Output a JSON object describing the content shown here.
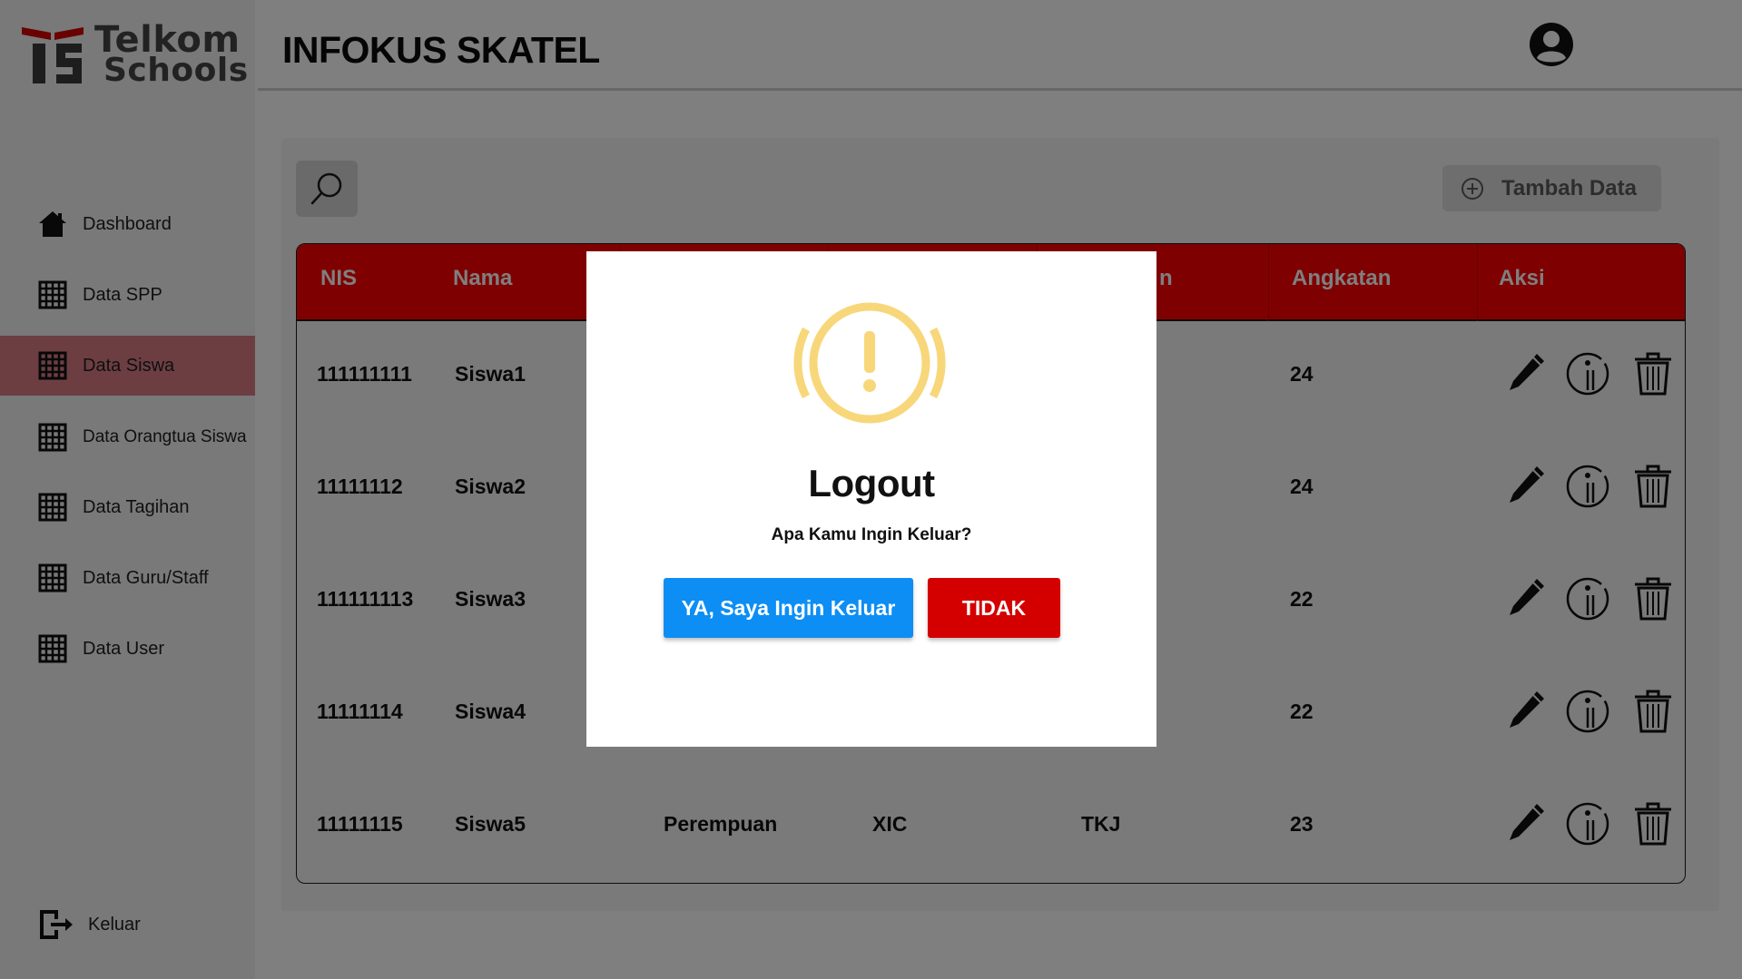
{
  "brand": {
    "line1": "Telkom",
    "line2": "Schools"
  },
  "sidebar": {
    "items": [
      {
        "label": "Dashboard",
        "icon": "home-icon"
      },
      {
        "label": "Data SPP",
        "icon": "grid-icon"
      },
      {
        "label": "Data Siswa",
        "icon": "grid-icon",
        "active": true
      },
      {
        "label": "Data Orangtua Siswa",
        "icon": "grid-icon"
      },
      {
        "label": "Data Tagihan",
        "icon": "grid-icon"
      },
      {
        "label": "Data Guru/Staff",
        "icon": "grid-icon"
      },
      {
        "label": "Data User",
        "icon": "grid-icon"
      }
    ],
    "logout_label": "Keluar"
  },
  "header": {
    "title": "INFOKUS SKATEL"
  },
  "toolbar": {
    "add_label": "Tambah Data"
  },
  "table": {
    "headers": [
      "NIS",
      "Nama",
      "",
      "",
      "n",
      "Angkatan",
      "Aksi"
    ],
    "rows": [
      {
        "nis": "111111111",
        "nama": "Siswa1",
        "gender": "",
        "kelas": "",
        "jurusan": "",
        "angkatan": "24"
      },
      {
        "nis": "11111112",
        "nama": "Siswa2",
        "gender": "",
        "kelas": "",
        "jurusan": "",
        "angkatan": "24"
      },
      {
        "nis": "111111113",
        "nama": "Siswa3",
        "gender": "",
        "kelas": "",
        "jurusan": "",
        "angkatan": "22"
      },
      {
        "nis": "11111114",
        "nama": "Siswa4",
        "gender": "",
        "kelas": "",
        "jurusan": "",
        "angkatan": "22"
      },
      {
        "nis": "11111115",
        "nama": "Siswa5",
        "gender": "Perempuan",
        "kelas": "XIC",
        "jurusan": "TKJ",
        "angkatan": "23"
      }
    ]
  },
  "modal": {
    "title": "Logout",
    "message": "Apa Kamu Ingin Keluar?",
    "confirm_label": "YA, Saya Ingin Keluar",
    "cancel_label": "TIDAK"
  },
  "colors": {
    "header_red": "#ff0000",
    "active_nav": "#d97d85",
    "confirm_blue": "#0c8ef5",
    "cancel_red": "#d40000",
    "warning_yellow": "#f7c531"
  }
}
